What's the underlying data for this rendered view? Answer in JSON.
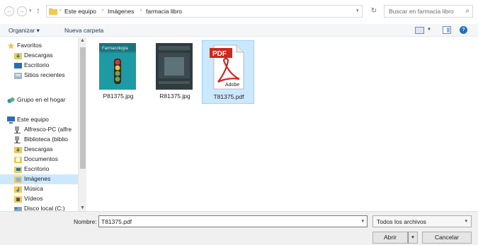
{
  "address_bar": {
    "breadcrumbs": [
      "Este equipo",
      "Imágenes",
      "farmacia libro"
    ],
    "search_placeholder": "Buscar en farmacia libro"
  },
  "toolbar": {
    "organize_label": "Organizar ▾",
    "new_folder_label": "Nueva carpeta"
  },
  "nav_pane": {
    "items": [
      {
        "label": "Favoritos",
        "icon": "star-icon"
      },
      {
        "label": "Descargas",
        "icon": "downloads-folder-icon"
      },
      {
        "label": "Escritorio",
        "icon": "desktop-icon"
      },
      {
        "label": "Sitios recientes",
        "icon": "recent-places-icon"
      },
      {
        "label": "Grupo en el hogar",
        "icon": "homegroup-icon"
      },
      {
        "label": "Este equipo",
        "icon": "computer-icon"
      },
      {
        "label": "Alfresco-PC (alfre",
        "icon": "network-drive-icon"
      },
      {
        "label": "Biblioteca (biblio",
        "icon": "network-drive-icon"
      },
      {
        "label": "Descargas",
        "icon": "downloads-folder-icon"
      },
      {
        "label": "Documentos",
        "icon": "documents-folder-icon"
      },
      {
        "label": "Escritorio",
        "icon": "desktop-folder-icon"
      },
      {
        "label": "Imágenes",
        "icon": "pictures-folder-icon"
      },
      {
        "label": "Música",
        "icon": "music-folder-icon"
      },
      {
        "label": "Vídeos",
        "icon": "videos-folder-icon"
      },
      {
        "label": "Disco local (C:)",
        "icon": "drive-icon"
      }
    ],
    "selected": "Imágenes"
  },
  "files": [
    {
      "name": "P81375.jpg",
      "kind": "image",
      "cover_title": "Farmacología"
    },
    {
      "name": "R81375.jpg",
      "kind": "image"
    },
    {
      "name": "T81375.pdf",
      "kind": "pdf",
      "badge": "PDF",
      "brand": "Adobe",
      "selected": true
    }
  ],
  "bottom": {
    "filename_label": "Nombre:",
    "filename_value": "T81375.pdf",
    "filter_value": "Todos los archivos",
    "open_label": "Abrir",
    "cancel_label": "Cancelar"
  },
  "colors": {
    "selection": "#cce8ff",
    "pdf_red": "#d0271d",
    "link_blue": "#1e395b"
  }
}
